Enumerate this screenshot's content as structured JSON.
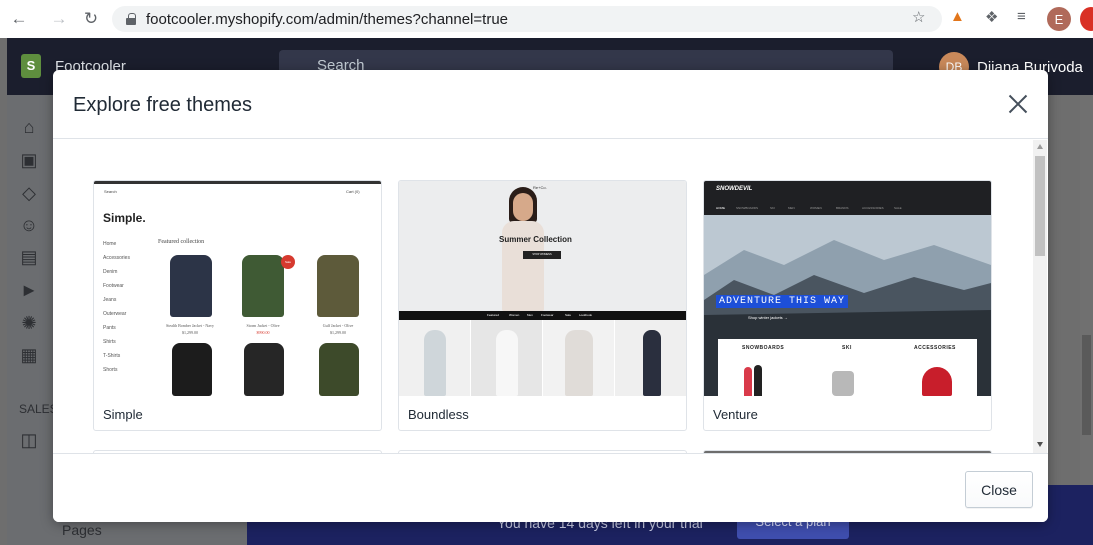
{
  "browser": {
    "url": "footcooler.myshopify.com/admin/themes?channel=true",
    "profile_initial": "E"
  },
  "admin": {
    "store_name": "Footcooler",
    "search_placeholder": "Search",
    "user_initials": "DB",
    "user_name": "Dijana Burivoda",
    "sidebar_section": "SALES",
    "sidebar_pages": "Pages",
    "trial_text": "You have 14 days left in your trial",
    "plan_button": "Select a plan"
  },
  "modal": {
    "title": "Explore free themes",
    "close_button": "Close",
    "themes": [
      {
        "name": "Simple"
      },
      {
        "name": "Boundless"
      },
      {
        "name": "Venture"
      }
    ]
  },
  "previews": {
    "simple": {
      "logo": "Simple.",
      "featured": "Featured collection",
      "nav": [
        "Home",
        "Accessories",
        "Denim",
        "Footwear",
        "Jeans",
        "Outerwear",
        "Pants",
        "Shirts",
        "T-Shirts",
        "Shorts"
      ],
      "search": "Search",
      "cart": "Cart (0)",
      "products": [
        {
          "name": "Stealth Bomber Jacket - Navy",
          "price": "$1,299.00"
        },
        {
          "name": "Storm Jacket - Olive",
          "price": "$990.00"
        },
        {
          "name": "Gulf Jacket - Olive",
          "price": "$1,299.00"
        }
      ],
      "sale_badge": "Sale"
    },
    "boundless": {
      "brand": "Re+Co.",
      "hero_title": "Summer Collection",
      "hero_button": "SHOP WOMENS",
      "nav": [
        "Featured",
        "Women",
        "Men",
        "Footwear",
        "Sale",
        "Lookbook"
      ]
    },
    "venture": {
      "logo": "SNOWDEVIL",
      "hero_text": "ADVENTURE THIS WAY",
      "hero_link": "Shop winter jackets →",
      "categories": [
        "SNOWBOARDS",
        "SKI",
        "ACCESSORIES"
      ],
      "nav": [
        "HOME",
        "SNOWBOARDS",
        "SKI",
        "MEN",
        "WOMEN",
        "BRANDS",
        "ACCESSORIES",
        "SALE"
      ]
    }
  },
  "colors": {
    "admin_topbar": "#1b1e2d",
    "trial_bar": "#1c2260",
    "venture_accent": "#1d4fd8",
    "shopify_green": "#5e8e3e"
  }
}
